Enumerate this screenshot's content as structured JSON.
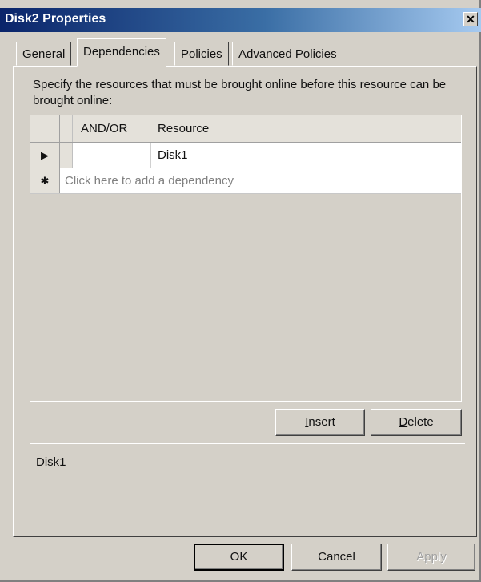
{
  "window": {
    "title": "Disk2 Properties",
    "close_glyph": "✕"
  },
  "tabs": [
    {
      "label": "General"
    },
    {
      "label": "Dependencies",
      "active": true
    },
    {
      "label": "Policies"
    },
    {
      "label": "Advanced Policies"
    }
  ],
  "dependencies": {
    "instructions": "Specify the resources that must be brought online before this resource can be brought online:",
    "columns": {
      "and_or": "AND/OR",
      "resource": "Resource"
    },
    "rows": [
      {
        "marker_icon": "current-row-arrow-icon",
        "marker": "▶",
        "and_or": "",
        "resource": "Disk1"
      }
    ],
    "new_row": {
      "marker_icon": "new-row-asterisk-icon",
      "marker": "✱",
      "placeholder": "Click here to add a dependency"
    },
    "buttons": {
      "insert": {
        "mnemonic": "I",
        "rest": "nsert"
      },
      "delete": {
        "mnemonic": "D",
        "rest": "elete"
      }
    },
    "selection_text": "Disk1"
  },
  "footer": {
    "ok": "OK",
    "cancel": "Cancel",
    "apply": "Apply",
    "apply_enabled": false
  },
  "colors": {
    "face": "#d4d0c8",
    "title_start": "#0a246a",
    "title_end": "#a6caf0"
  }
}
